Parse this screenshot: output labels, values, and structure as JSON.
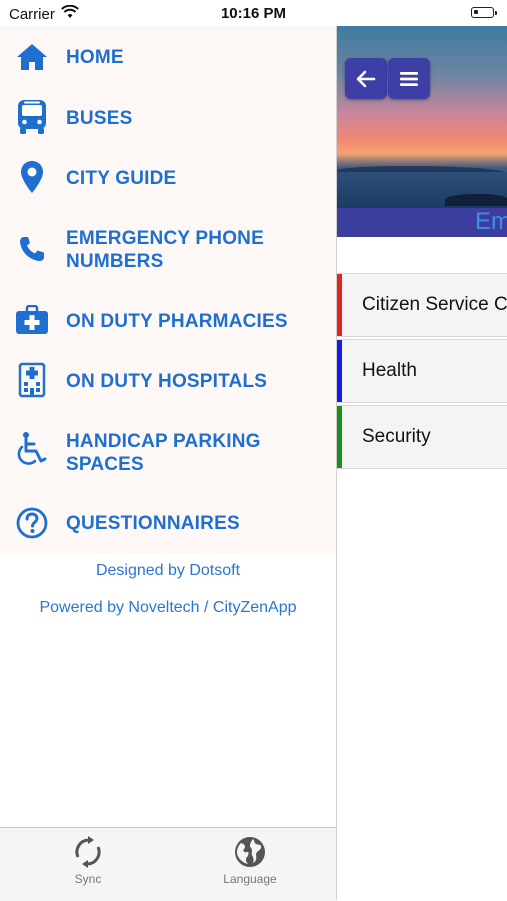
{
  "status_bar": {
    "carrier": "Carrier",
    "time": "10:16 PM"
  },
  "drawer": {
    "items": [
      {
        "label": "HOME",
        "icon": "home-icon"
      },
      {
        "label": "BUSES",
        "icon": "bus-icon"
      },
      {
        "label": "CITY GUIDE",
        "icon": "map-pin-icon"
      },
      {
        "label_line1": "EMERGENCY PHONE",
        "label_line2": "NUMBERS",
        "icon": "phone-icon"
      },
      {
        "label": "ON DUTY PHARMACIES",
        "icon": "medical-kit-icon"
      },
      {
        "label": "ON DUTY HOSPITALS",
        "icon": "hospital-building-icon"
      },
      {
        "label_line1": "HANDICAP PARKING",
        "label_line2": "SPACES",
        "icon": "wheelchair-icon"
      },
      {
        "label": "QUESTIONNAIRES",
        "icon": "question-circle-icon"
      }
    ],
    "credits": [
      "Designed by Dotsoft",
      "Powered by Noveltech / CityZenApp"
    ],
    "footer": {
      "sync_label": "Sync",
      "language_label": "Language"
    }
  },
  "main": {
    "title": "Em",
    "categories": [
      {
        "label": "Citizen Service C",
        "color": "#e8231f"
      },
      {
        "label": "Health",
        "color": "#1a1ae6"
      },
      {
        "label": "Security",
        "color": "#1b8e1b"
      }
    ]
  },
  "colors": {
    "accent": "#1f6fd1",
    "nav_button": "#3d3fa6"
  }
}
